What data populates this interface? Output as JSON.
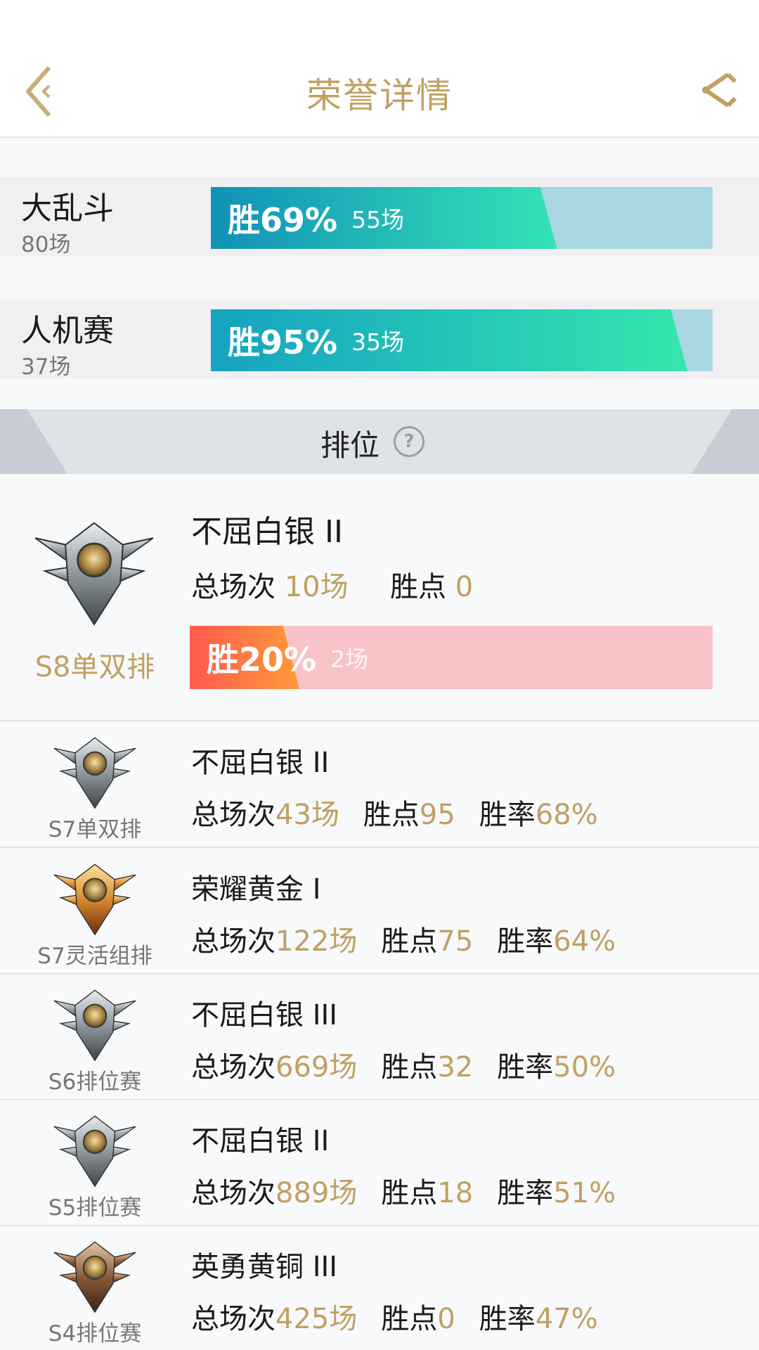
{
  "header": {
    "title": "荣誉详情"
  },
  "modes": [
    {
      "name": "大乱斗",
      "total": "80场",
      "win_pct_label": "胜69%",
      "wins": "55场",
      "win_fraction": 0.69,
      "gradient": [
        "#1191b8",
        "#34e3b5"
      ]
    },
    {
      "name": "人机赛",
      "total": "37场",
      "win_pct_label": "胜95%",
      "wins": "35场",
      "win_fraction": 0.95,
      "gradient": [
        "#15a2c2",
        "#34e6ad"
      ]
    }
  ],
  "ranked": {
    "title": "排位",
    "help_icon": "?",
    "current": {
      "season": "S8单双排",
      "tier": "不屈白银 II",
      "total_label": "总场次",
      "total": "10场",
      "points_label": "胜点",
      "points": "0",
      "win_pct_label": "胜20%",
      "wins": "2场",
      "win_fraction": 0.2,
      "badge": "silver"
    },
    "history": [
      {
        "season": "S7单双排",
        "tier": "不屈白银 II",
        "total_label": "总场次",
        "total": "43场",
        "points_label": "胜点",
        "points": "95",
        "rate_label": "胜率",
        "rate": "68%",
        "badge": "silver"
      },
      {
        "season": "S7灵活组排",
        "tier": "荣耀黄金 I",
        "total_label": "总场次",
        "total": "122场",
        "points_label": "胜点",
        "points": "75",
        "rate_label": "胜率",
        "rate": "64%",
        "badge": "gold"
      },
      {
        "season": "S6排位赛",
        "tier": "不屈白银 III",
        "total_label": "总场次",
        "total": "669场",
        "points_label": "胜点",
        "points": "32",
        "rate_label": "胜率",
        "rate": "50%",
        "badge": "silver"
      },
      {
        "season": "S5排位赛",
        "tier": "不屈白银 II",
        "total_label": "总场次",
        "total": "889场",
        "points_label": "胜点",
        "points": "18",
        "rate_label": "胜率",
        "rate": "51%",
        "badge": "silver"
      },
      {
        "season": "S4排位赛",
        "tier": "英勇黄铜 III",
        "total_label": "总场次",
        "total": "425场",
        "points_label": "胜点",
        "points": "0",
        "rate_label": "胜率",
        "rate": "47%",
        "badge": "bronze"
      }
    ]
  }
}
